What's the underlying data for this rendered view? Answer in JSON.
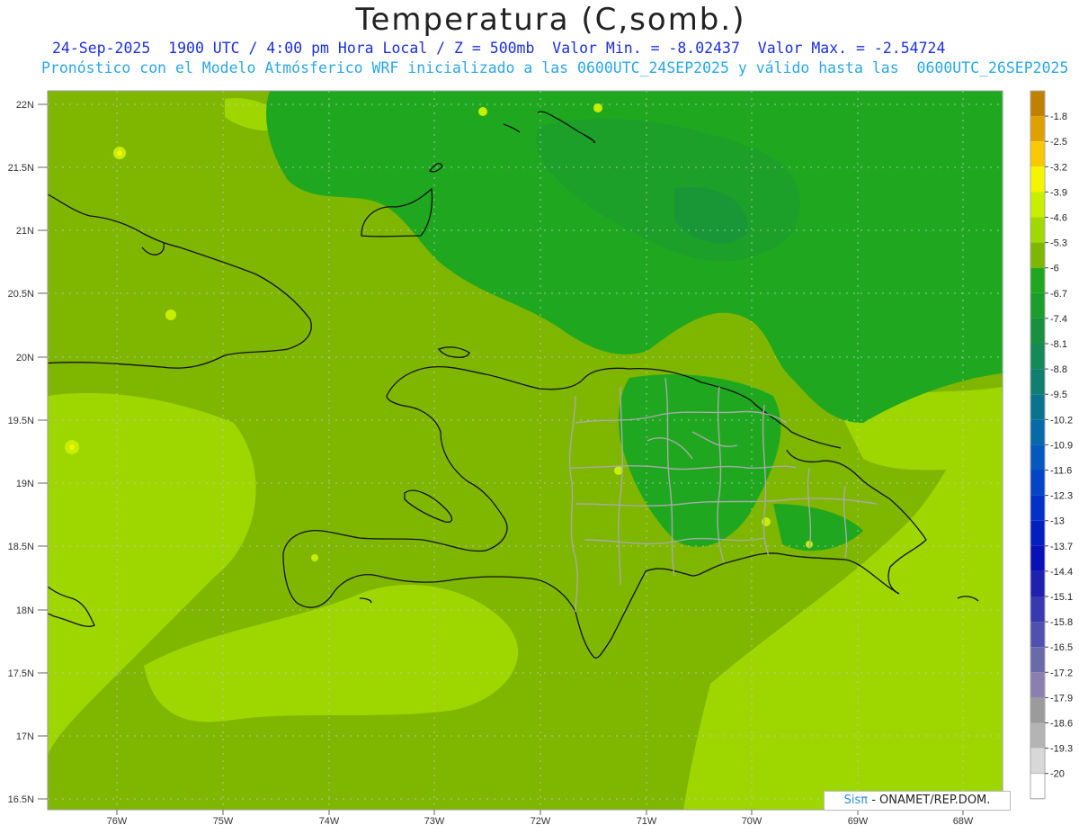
{
  "header": {
    "title": "Temperatura (C,somb.)",
    "subtitle_line1": "24-Sep-2025  1900 UTC / 4:00 pm Hora Local / Z = 500mb  Valor Min. = -8.02437  Valor Max. = -2.54724",
    "subtitle_line2": "Pronóstico con el Modelo Atmósferico WRF inicializado a las 0600UTC_24SEP2025 y válido hasta las  0600UTC_26SEP2025"
  },
  "map": {
    "lat_labels": [
      "22N",
      "21.5N",
      "21N",
      "20.5N",
      "20N",
      "19.5N",
      "19N",
      "18.5N",
      "18N",
      "17.5N",
      "17N",
      "16.5N"
    ],
    "lon_labels": [
      "76W",
      "75W",
      "74W",
      "73W",
      "72W",
      "71W",
      "70W",
      "69W",
      "68W"
    ]
  },
  "legend": {
    "labels": [
      "-1.8",
      "-2.5",
      "-3.2",
      "-3.9",
      "-4.6",
      "-5.3",
      "-6",
      "-6.7",
      "-7.4",
      "-8.1",
      "-8.8",
      "-9.5",
      "-10.2",
      "-10.9",
      "-11.6",
      "-12.3",
      "-13",
      "-13.7",
      "-14.4",
      "-15.1",
      "-15.8",
      "-16.5",
      "-17.2",
      "-17.9",
      "-18.6",
      "-19.3",
      "-20"
    ],
    "colors": [
      "#c08000",
      "#e0a000",
      "#f8c800",
      "#f5f500",
      "#c8ee00",
      "#a0d800",
      "#7fb600",
      "#1fa81f",
      "#1b9e2c",
      "#17913f",
      "#148a58",
      "#0f7f70",
      "#0a7490",
      "#076aa8",
      "#0558c0",
      "#0444c8",
      "#0330c8",
      "#0220c0",
      "#0a10b8",
      "#2020b0",
      "#3838b0",
      "#5050b0",
      "#6a6aaa",
      "#8a80b0",
      "#9b9b9b",
      "#b4b4b4",
      "#d8d8d8"
    ],
    "bottom_color": "#ffffff"
  },
  "credit": {
    "sis": "Sisπ",
    "text": "- ONAMET/REP.DOM."
  }
}
